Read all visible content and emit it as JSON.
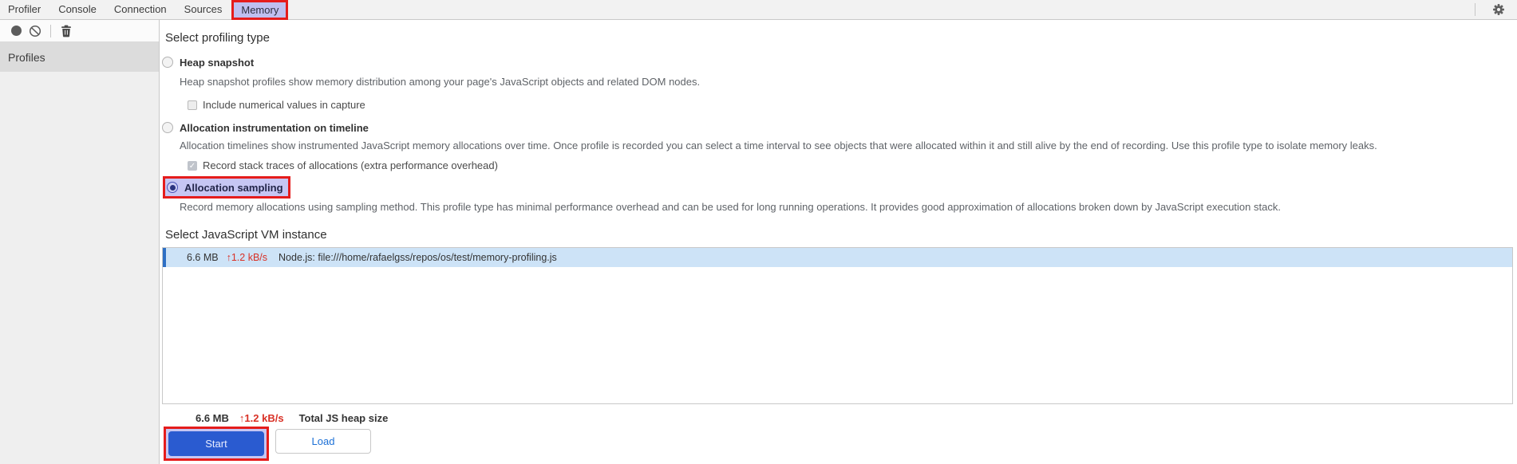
{
  "tabs": {
    "items": [
      {
        "label": "Profiler"
      },
      {
        "label": "Console"
      },
      {
        "label": "Connection"
      },
      {
        "label": "Sources"
      },
      {
        "label": "Memory",
        "selected": true,
        "annotated": true
      }
    ]
  },
  "toolbar": {
    "icons": [
      "record-icon",
      "block-icon",
      "trash-icon"
    ]
  },
  "sidebar": {
    "profiles_label": "Profiles"
  },
  "main": {
    "profiling_heading": "Select profiling type",
    "types": [
      {
        "label": "Heap snapshot",
        "selected": false,
        "description": "Heap snapshot profiles show memory distribution among your page's JavaScript objects and related DOM nodes.",
        "checkbox": {
          "label": "Include numerical values in capture",
          "checked": false
        }
      },
      {
        "label": "Allocation instrumentation on timeline",
        "selected": false,
        "description": "Allocation timelines show instrumented JavaScript memory allocations over time. Once profile is recorded you can select a time interval to see objects that were allocated within it and still alive by the end of recording. Use this profile type to isolate memory leaks.",
        "checkbox": {
          "label": "Record stack traces of allocations (extra performance overhead)",
          "checked": true,
          "check_glyph": "✓"
        }
      },
      {
        "label": "Allocation sampling",
        "selected": true,
        "annotated": true,
        "description": "Record memory allocations using sampling method. This profile type has minimal performance overhead and can be used for long running operations. It provides good approximation of allocations broken down by JavaScript execution stack."
      }
    ],
    "vm_heading": "Select JavaScript VM instance",
    "vm_row": {
      "size": "6.6 MB",
      "rate": "↑1.2 kB/s",
      "name": "Node.js: file:///home/rafaelgss/repos/os/test/memory-profiling.js"
    },
    "totals": {
      "size": "6.6 MB",
      "rate": "↑1.2 kB/s",
      "label": "Total JS heap size"
    },
    "buttons": {
      "start": "Start",
      "load": "Load"
    }
  },
  "colors": {
    "annotation_red": "#e51c1c",
    "highlight_lavender": "#c6c6f3",
    "selected_row_blue": "#cde3f7",
    "row_accent_blue": "#2e6fc4",
    "rate_red": "#d93025",
    "primary_button_blue": "#2a5bd0",
    "link_blue": "#1b6fd6",
    "tab_selected_lavender": "#bfbff0"
  }
}
